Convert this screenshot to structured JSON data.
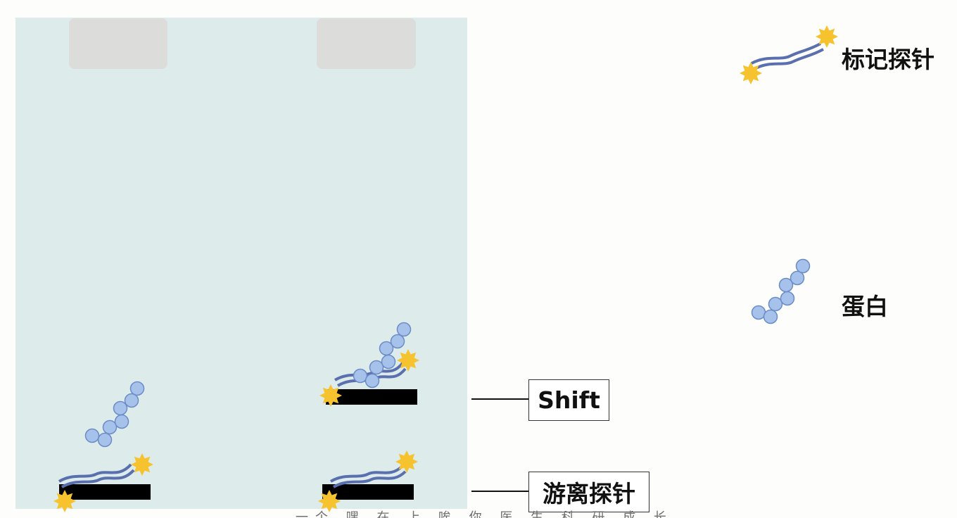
{
  "legend": {
    "probe_label": "标记探针",
    "protein_label": "蛋白"
  },
  "bands": {
    "shift_label": "Shift",
    "free_probe_label": "游离探针"
  },
  "caption": "一个 嘿 在 上 唉 你 医 生 科 研 成 长",
  "colors": {
    "gel_background": "#ddeceb",
    "probe_strand": "#5a6fae",
    "protein_bead_fill": "#a7c2ea",
    "protein_bead_stroke": "#6a8bc8",
    "label_star": "#f6c22d",
    "band": "#000000"
  }
}
